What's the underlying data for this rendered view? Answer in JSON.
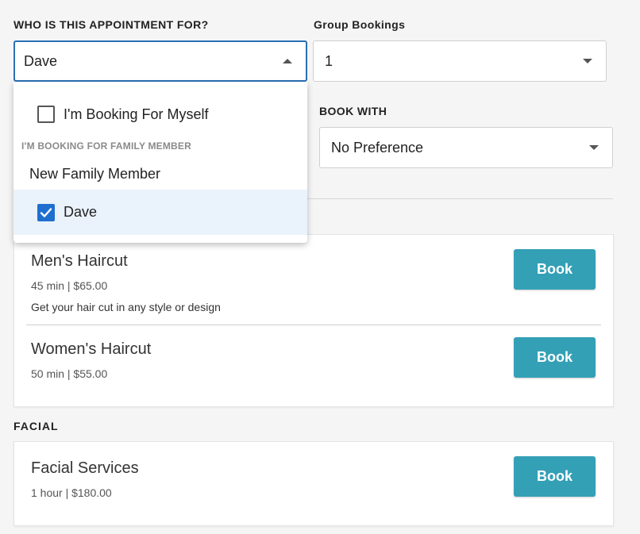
{
  "who_for": {
    "label": "WHO IS THIS APPOINTMENT FOR?",
    "selected": "Dave",
    "options": {
      "myself": "I'm Booking For Myself",
      "group_header": "I'M BOOKING FOR FAMILY MEMBER",
      "new_member": "New Family Member",
      "dave": "Dave"
    }
  },
  "group_bookings": {
    "label": "Group Bookings",
    "value": "1"
  },
  "book_with": {
    "label": "BOOK WITH",
    "value": "No Preference"
  },
  "sections": [
    {
      "services": [
        {
          "name": "Men's Haircut",
          "meta": "45 min | $65.00",
          "description": "Get your hair cut in any style or design",
          "button": "Book"
        },
        {
          "name": "Women's Haircut",
          "meta": "50 min | $55.00",
          "button": "Book"
        }
      ]
    },
    {
      "title": "FACIAL",
      "services": [
        {
          "name": "Facial Services",
          "meta": "1 hour | $180.00",
          "button": "Book"
        }
      ]
    }
  ],
  "colors": {
    "accent": "#34a0b6",
    "focus_border": "#2a6fb5",
    "checkbox_checked": "#1f6fcf",
    "selected_row": "#eaf2fb"
  }
}
